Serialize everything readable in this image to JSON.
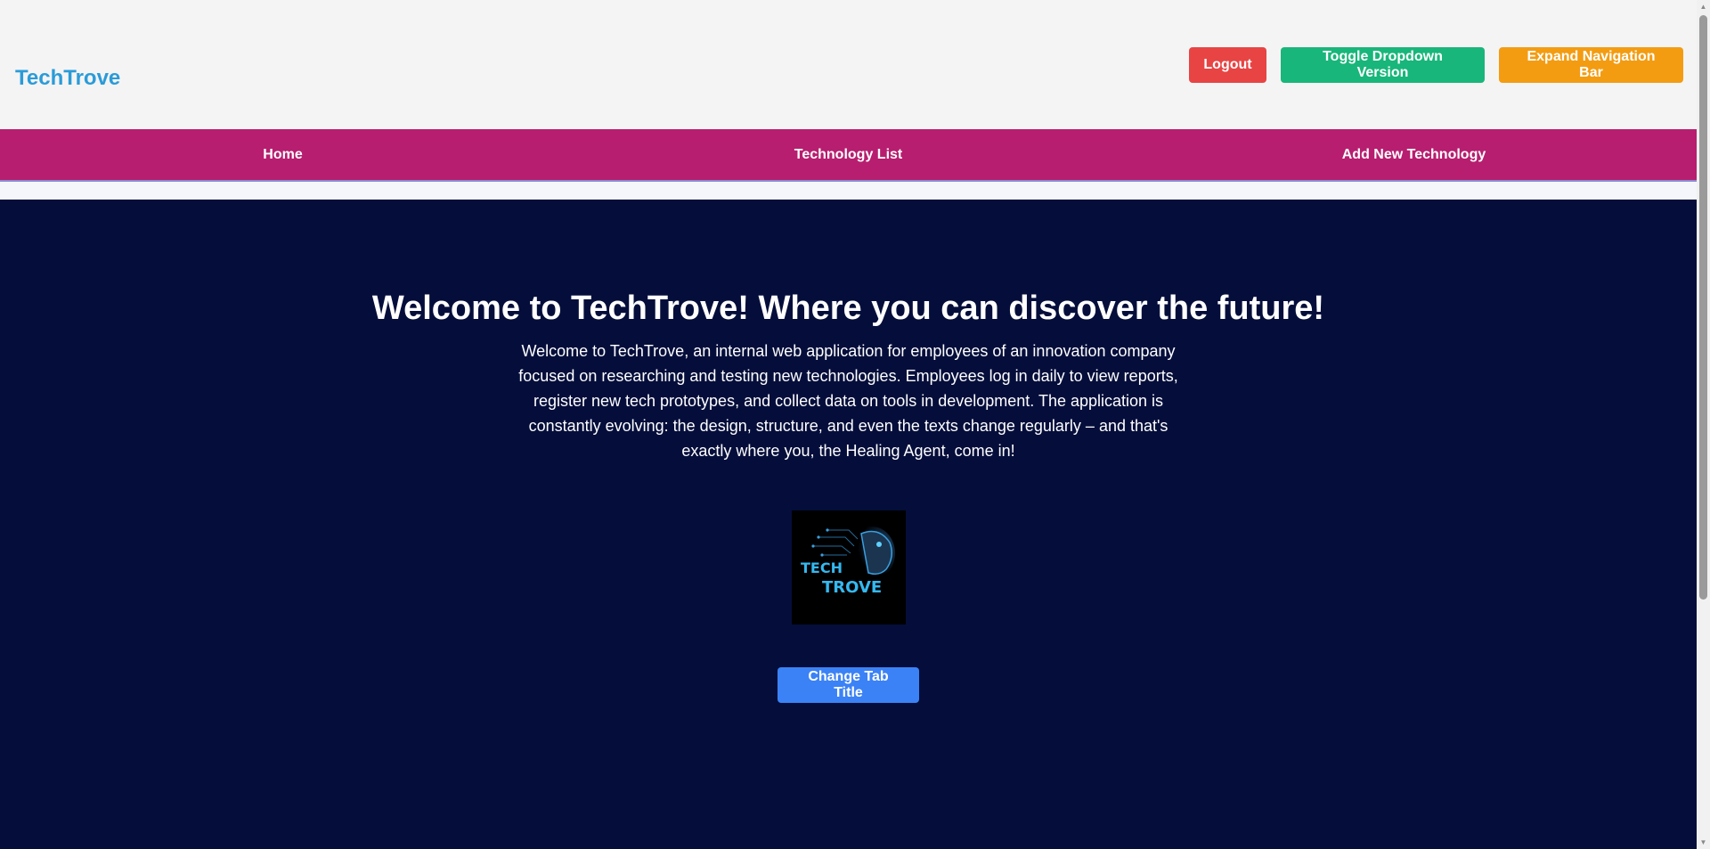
{
  "header": {
    "brand": "TechTrove",
    "buttons": {
      "logout": "Logout",
      "toggle_dropdown": "Toggle Dropdown Version",
      "expand_nav": "Expand Navigation Bar"
    }
  },
  "nav": {
    "items": [
      "Home",
      "Technology List",
      "Add New Technology"
    ]
  },
  "hero": {
    "title": "Welcome to TechTrove! Where you can discover the future!",
    "description": "Welcome to TechTrove, an internal web application for employees of an innovation company focused on researching and testing new technologies. Employees log in daily to view reports, register new tech prototypes, and collect data on tools in development. The application is constantly evolving: the design, structure, and even the texts change regularly – and that's exactly where you, the Healing Agent, come in!",
    "logo_text_line1": "TECH",
    "logo_text_line2": "TROVE",
    "change_tab_button": "Change Tab Title"
  },
  "colors": {
    "brand": "#2b9bd8",
    "logout": "#e84444",
    "toggle_dropdown": "#18b67a",
    "expand_nav": "#f39c12",
    "nav_bg": "#b71e6f",
    "hero_bg": "#050e3b",
    "change_tab": "#3b82f6"
  }
}
